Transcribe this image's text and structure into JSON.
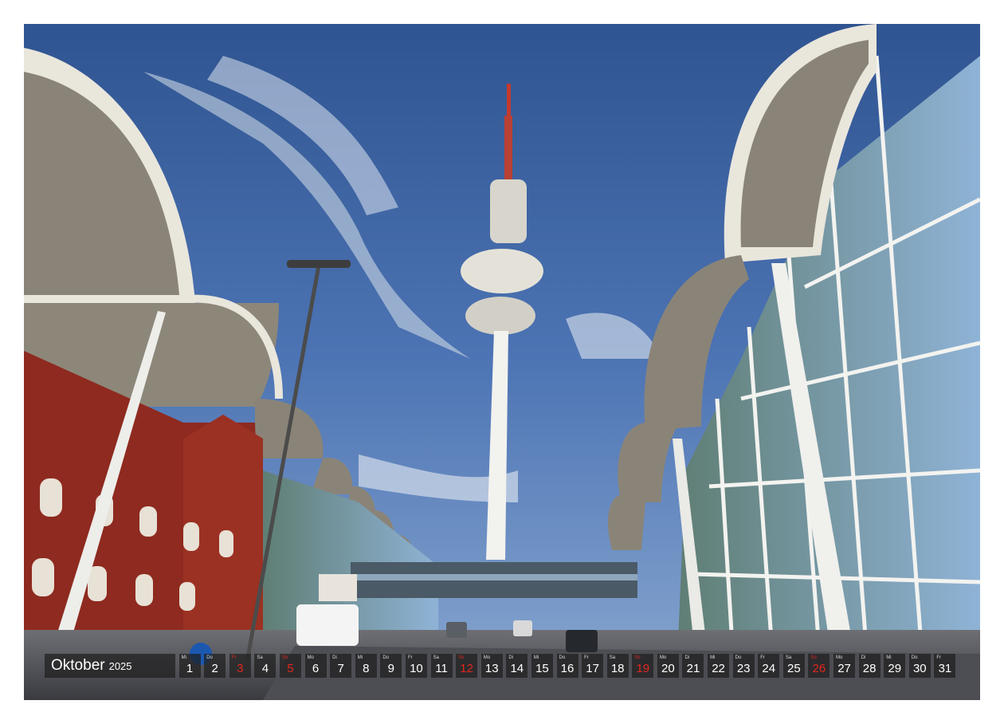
{
  "calendar": {
    "month": "Oktober",
    "year": "2025",
    "days": [
      {
        "wd": "Mi",
        "n": "1"
      },
      {
        "wd": "Do",
        "n": "2"
      },
      {
        "wd": "Fr",
        "n": "3",
        "red": true
      },
      {
        "wd": "Sa",
        "n": "4"
      },
      {
        "wd": "So",
        "n": "5",
        "red": true
      },
      {
        "wd": "Mo",
        "n": "6"
      },
      {
        "wd": "Di",
        "n": "7"
      },
      {
        "wd": "Mi",
        "n": "8"
      },
      {
        "wd": "Do",
        "n": "9"
      },
      {
        "wd": "Fr",
        "n": "10"
      },
      {
        "wd": "Sa",
        "n": "11"
      },
      {
        "wd": "So",
        "n": "12",
        "red": true
      },
      {
        "wd": "Mo",
        "n": "13"
      },
      {
        "wd": "Di",
        "n": "14"
      },
      {
        "wd": "Mi",
        "n": "15"
      },
      {
        "wd": "Do",
        "n": "16"
      },
      {
        "wd": "Fr",
        "n": "17"
      },
      {
        "wd": "Sa",
        "n": "18"
      },
      {
        "wd": "So",
        "n": "19",
        "red": true
      },
      {
        "wd": "Mo",
        "n": "20"
      },
      {
        "wd": "Di",
        "n": "21"
      },
      {
        "wd": "Mi",
        "n": "22"
      },
      {
        "wd": "Do",
        "n": "23"
      },
      {
        "wd": "Fr",
        "n": "24"
      },
      {
        "wd": "Sa",
        "n": "25"
      },
      {
        "wd": "So",
        "n": "26",
        "red": true
      },
      {
        "wd": "Mo",
        "n": "27"
      },
      {
        "wd": "Di",
        "n": "28"
      },
      {
        "wd": "Mi",
        "n": "29"
      },
      {
        "wd": "Do",
        "n": "30"
      },
      {
        "wd": "Fr",
        "n": "31"
      }
    ]
  },
  "colors": {
    "holiday": "#e3261e",
    "sky": "#3a5f9e",
    "brick": "#8e2a1f"
  }
}
